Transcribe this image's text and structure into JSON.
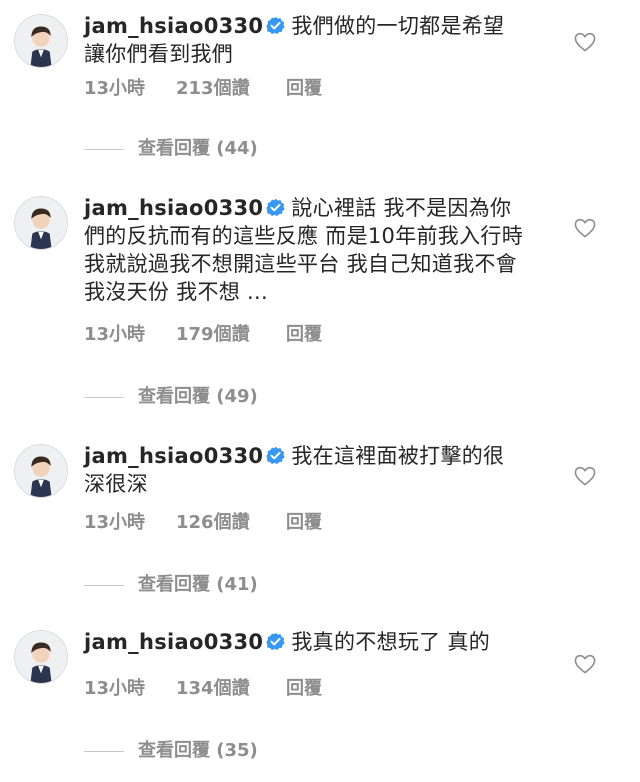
{
  "comments": [
    {
      "username": "jam_hsiao0330",
      "text": "我們做的一切都是希望讓你們看到我們",
      "time": "13小時",
      "likes": "213個讚",
      "reply": "回覆",
      "view_replies": "查看回覆 (44)"
    },
    {
      "username": "jam_hsiao0330",
      "text": "說心裡話 我不是因為你們的反抗而有的這些反應 而是10年前我入行時 我就說過我不想開這些平台 我自己知道我不會 我沒天份 我不想 ...",
      "time": "13小時",
      "likes": "179個讚",
      "reply": "回覆",
      "view_replies": "查看回覆 (49)"
    },
    {
      "username": "jam_hsiao0330",
      "text": "我在這裡面被打擊的很深很深",
      "time": "13小時",
      "likes": "126個讚",
      "reply": "回覆",
      "view_replies": "查看回覆 (41)"
    },
    {
      "username": "jam_hsiao0330",
      "text": "我真的不想玩了 真的",
      "time": "13小時",
      "likes": "134個讚",
      "reply": "回覆",
      "view_replies": "查看回覆 (35)"
    }
  ],
  "colors": {
    "text": "#262626",
    "meta": "#8e8e8e",
    "verified": "#3897f0"
  },
  "icons": {
    "verified": "verified-badge-icon",
    "like": "heart-outline-icon",
    "avatar": "cartoon-avatar"
  }
}
